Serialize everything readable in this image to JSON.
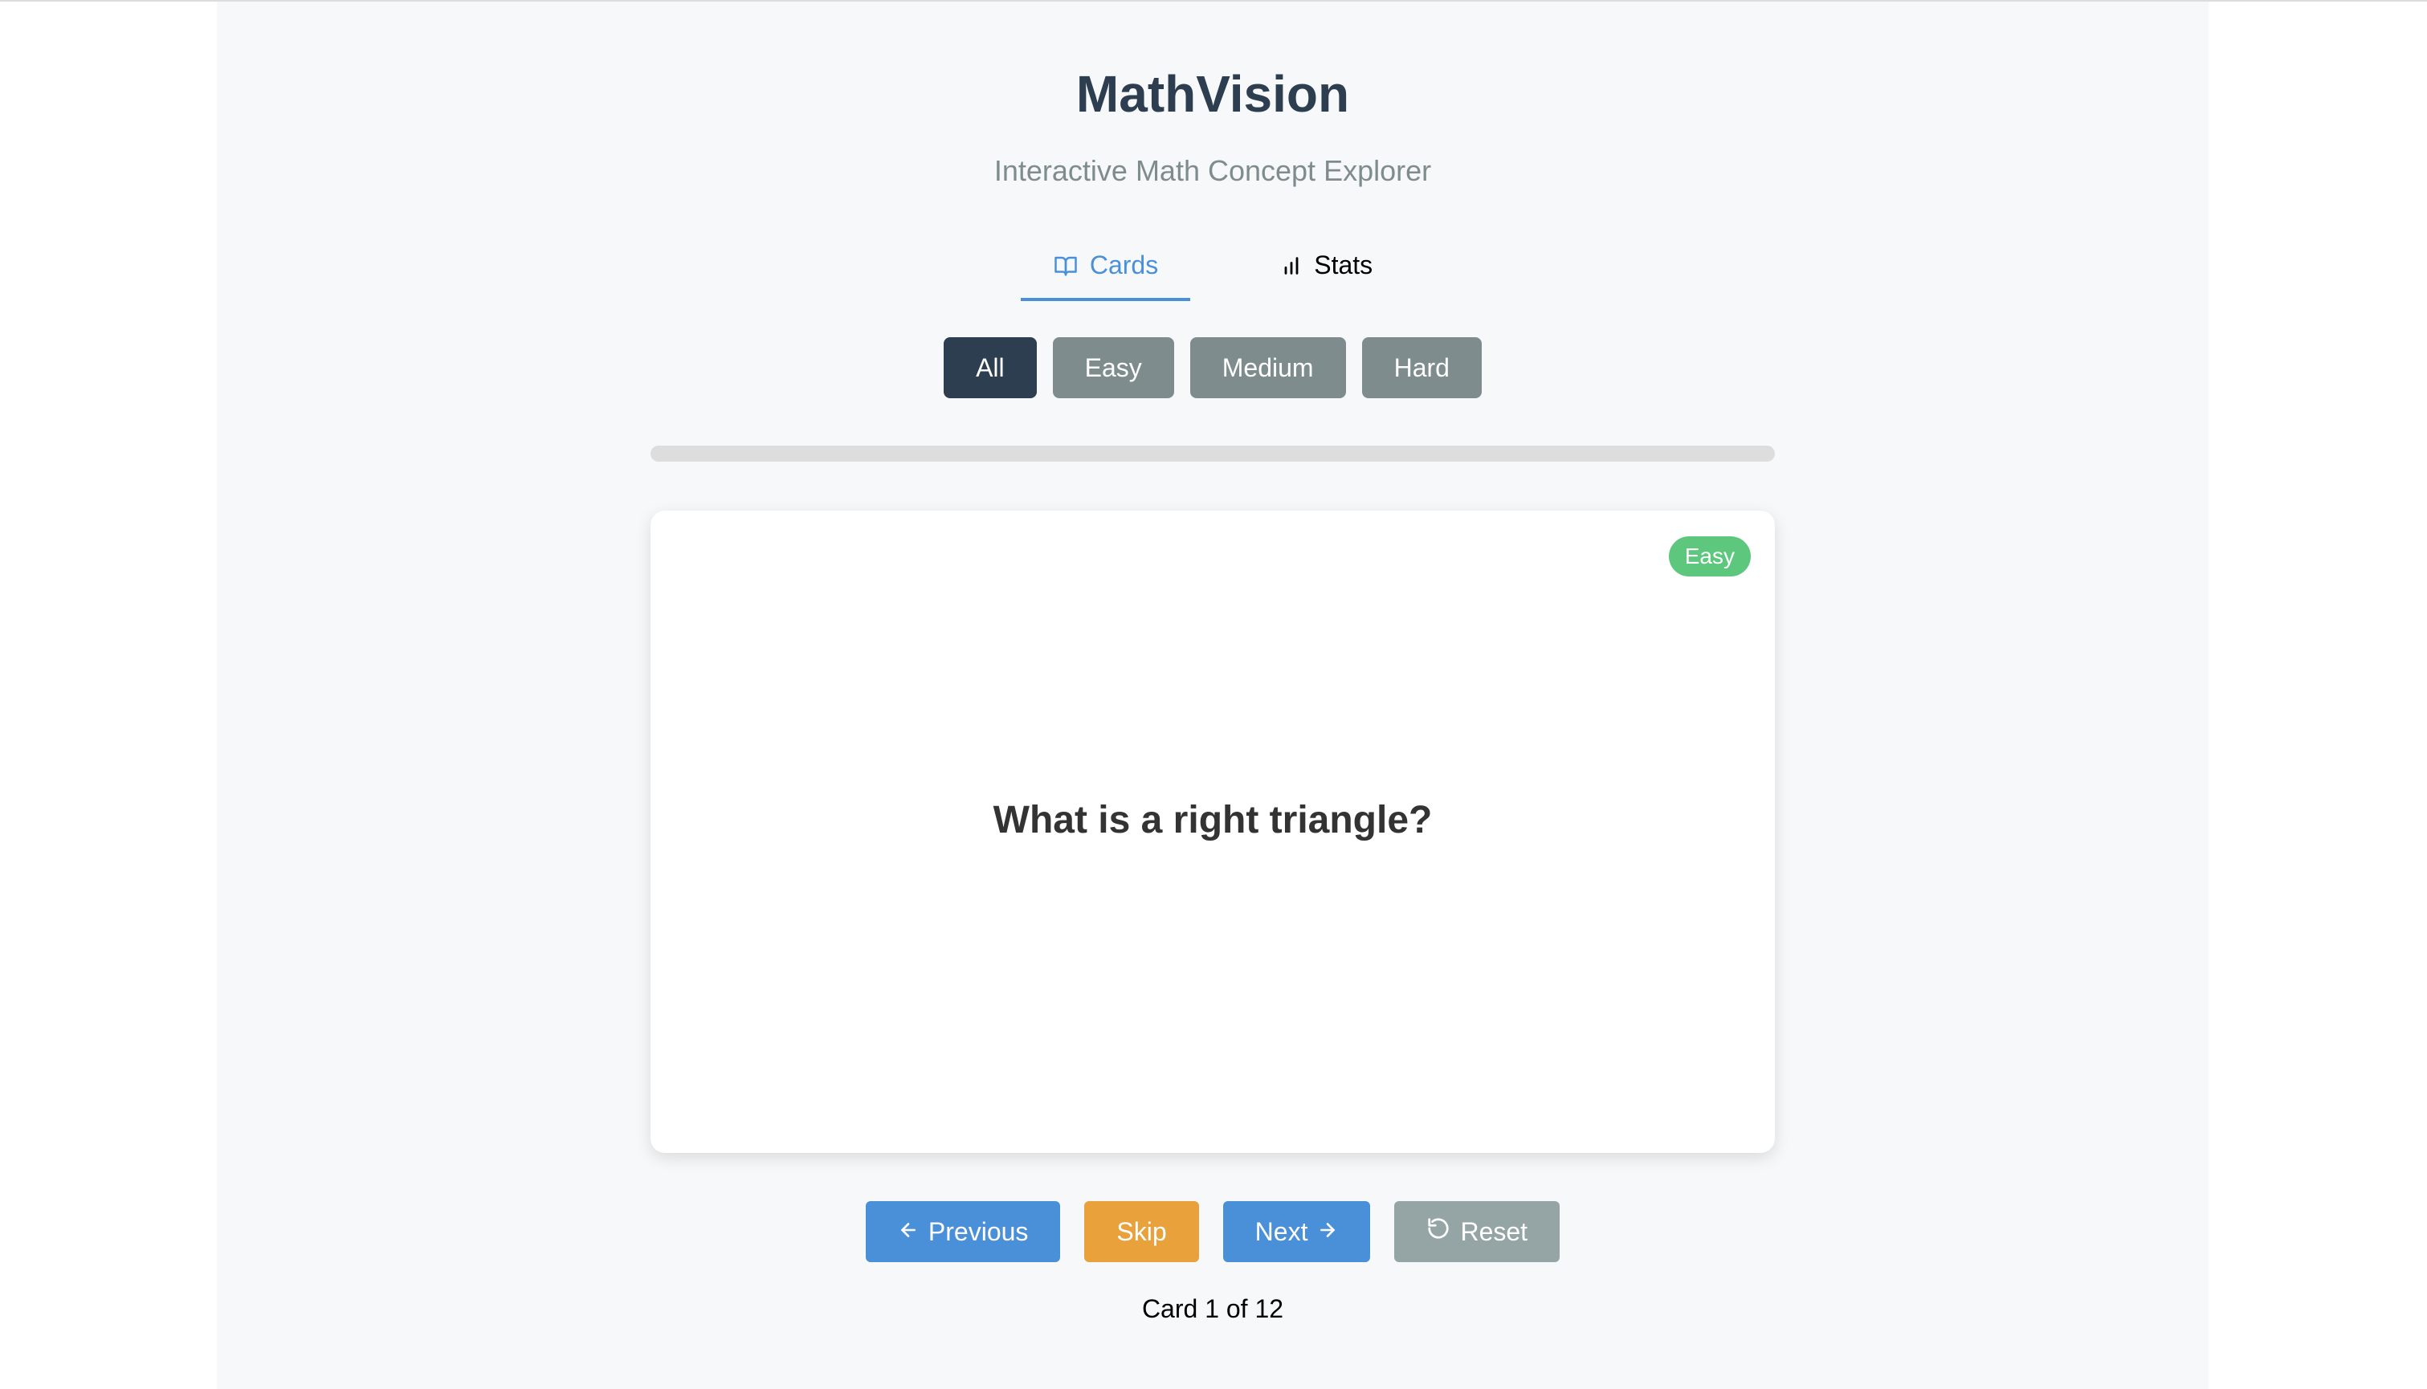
{
  "header": {
    "title": "MathVision",
    "subtitle": "Interactive Math Concept Explorer"
  },
  "tabs": [
    {
      "label": "Cards",
      "icon": "book-open-icon",
      "active": true
    },
    {
      "label": "Stats",
      "icon": "bar-chart-icon",
      "active": false
    }
  ],
  "filters": [
    {
      "label": "All",
      "active": true
    },
    {
      "label": "Easy",
      "active": false
    },
    {
      "label": "Medium",
      "active": false
    },
    {
      "label": "Hard",
      "active": false
    }
  ],
  "progress": {
    "fraction": 0
  },
  "card": {
    "difficulty": "Easy",
    "question": "What is a right triangle?"
  },
  "nav": {
    "previous_label": "Previous",
    "skip_label": "Skip",
    "next_label": "Next",
    "reset_label": "Reset"
  },
  "counter": "Card 1 of 12",
  "colors": {
    "accent": "#4a90d9",
    "dark": "#2c3e50",
    "muted": "#7f8c8d",
    "easy": "#5cc77d",
    "skip": "#e8a13b",
    "reset": "#95a5a6"
  }
}
